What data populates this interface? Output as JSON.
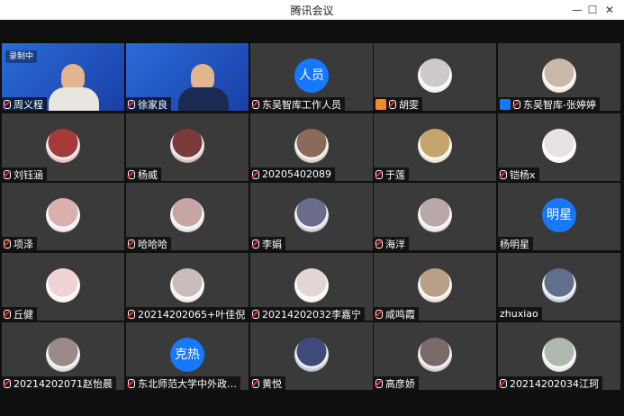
{
  "window": {
    "title": "腾讯会议",
    "minimize": "—",
    "maximize": "☐",
    "close": "✕"
  },
  "video_tiles": [
    {
      "name": "周义程",
      "recording": "录制中"
    },
    {
      "name": "徐家良",
      "recording": ""
    }
  ],
  "participants": [
    {
      "name": "东吴智库工作人员",
      "avatar_text": "人员",
      "badge": ""
    },
    {
      "name": "胡雯",
      "avatar_text": "",
      "badge": "orange"
    },
    {
      "name": "东吴智库-张婷婷",
      "avatar_text": "",
      "badge": "blue"
    },
    {
      "name": "刘钰涵",
      "avatar_text": "",
      "badge": ""
    },
    {
      "name": "杨威",
      "avatar_text": "",
      "badge": ""
    },
    {
      "name": "20205402089",
      "avatar_text": "",
      "badge": ""
    },
    {
      "name": "于莲",
      "avatar_text": "",
      "badge": ""
    },
    {
      "name": "铠杨x",
      "avatar_text": "",
      "badge": ""
    },
    {
      "name": "项泽",
      "avatar_text": "",
      "badge": ""
    },
    {
      "name": "哈哈哈",
      "avatar_text": "",
      "badge": ""
    },
    {
      "name": "李娟",
      "avatar_text": "",
      "badge": ""
    },
    {
      "name": "海洋",
      "avatar_text": "",
      "badge": ""
    },
    {
      "name": "杨明星",
      "avatar_text": "明星",
      "badge": "",
      "muted": false
    },
    {
      "name": "丘健",
      "avatar_text": "",
      "badge": ""
    },
    {
      "name": "20214202065+叶佳倪",
      "avatar_text": "",
      "badge": ""
    },
    {
      "name": "20214202032李嘉宁",
      "avatar_text": "",
      "badge": ""
    },
    {
      "name": "咸鸣霞",
      "avatar_text": "",
      "badge": ""
    },
    {
      "name": "zhuxiao",
      "avatar_text": "",
      "badge": "",
      "muted": false
    },
    {
      "name": "20214202071赵怡晨",
      "avatar_text": "",
      "badge": ""
    },
    {
      "name": "东北师范大学中外政…",
      "avatar_text": "克热",
      "badge": ""
    },
    {
      "name": "黄悦",
      "avatar_text": "",
      "badge": ""
    },
    {
      "name": "高彦娇",
      "avatar_text": "",
      "badge": ""
    },
    {
      "name": "20214202034江珂",
      "avatar_text": "",
      "badge": ""
    }
  ],
  "colors": {
    "tile": "#3a3a3a",
    "accent": "#1677ff",
    "background": "#0f0f0f"
  }
}
